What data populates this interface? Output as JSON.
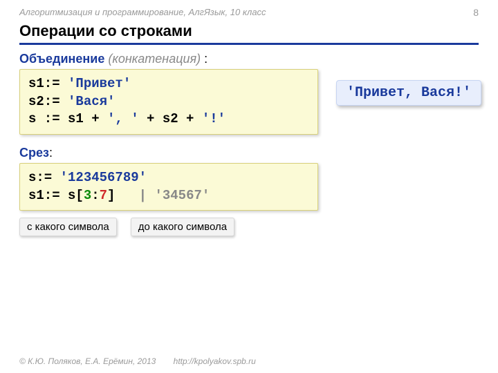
{
  "meta": {
    "series": "Алгоритмизация и программирование, АлгЯзык, 10 класс",
    "page_number": "8"
  },
  "title": "Операции со строками",
  "sections": {
    "concat": {
      "label_main": "Объединение",
      "label_sub": "(конкатенация)",
      "label_colon": " :",
      "code": {
        "l1a": "s1:= ",
        "l1b": "'Привет'",
        "l2a": "s2:= ",
        "l2b": "'Вася'",
        "l3a": "s := s1 + ",
        "l3b": "', '",
        "l3c": " + s2 + ",
        "l3d": "'!'"
      },
      "result": "'Привет, Вася!'"
    },
    "slice": {
      "label_main": "Срез",
      "label_colon": ":",
      "code": {
        "l1a": "s:= ",
        "l1b": "'123456789'",
        "l2a": "s1:= s[",
        "l2b": "3",
        "l2c": ":",
        "l2d": "7",
        "l2e": "]   ",
        "l2f": "| '34567'"
      },
      "annot_from": "с какого символа",
      "annot_to": "до какого символа"
    }
  },
  "footer": {
    "copyright": "© К.Ю. Поляков, Е.А. Ерёмин, 2013",
    "url": "http://kpolyakov.spb.ru"
  }
}
